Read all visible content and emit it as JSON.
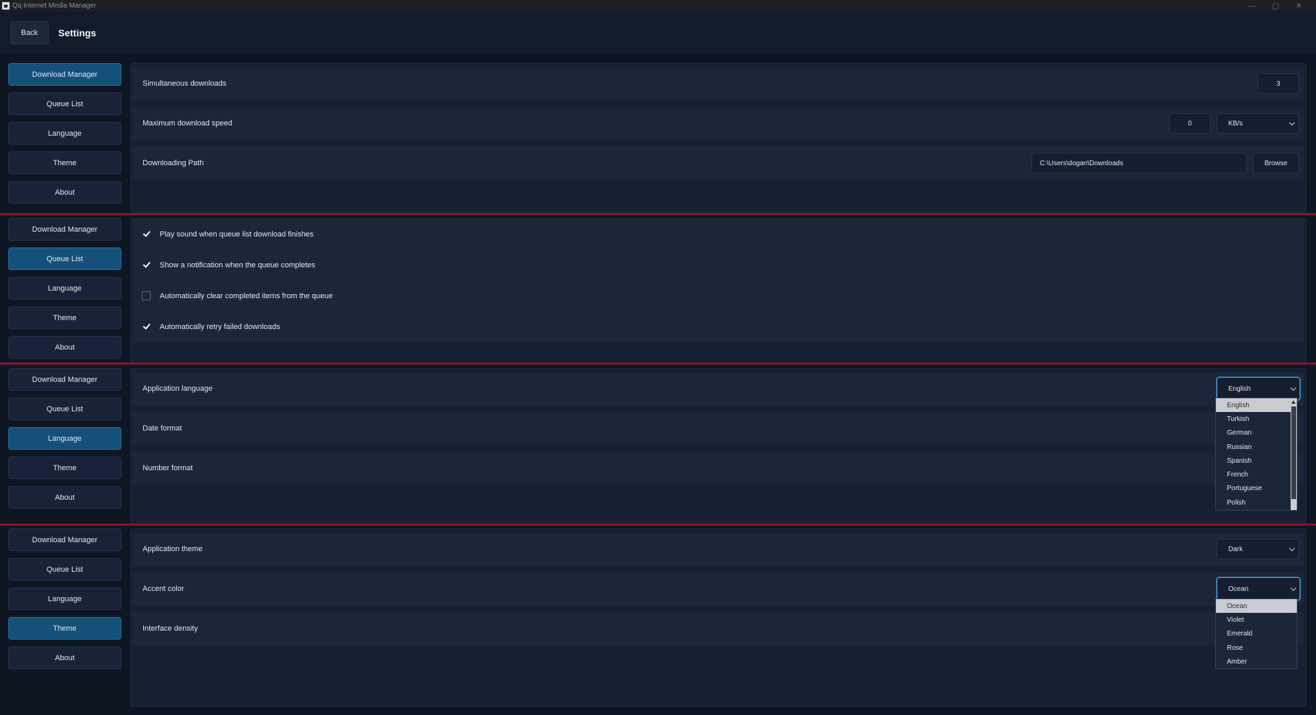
{
  "window": {
    "title": "Qq Internet Media Manager",
    "controls": [
      "—",
      "▢",
      "✕"
    ]
  },
  "header": {
    "back_label": "Back",
    "title": "Settings"
  },
  "nav": {
    "download_manager": "Download Manager",
    "queue_list": "Queue List",
    "language": "Language",
    "theme": "Theme",
    "about": "About"
  },
  "download_manager": {
    "simultaneous_label": "Simultaneous downloads",
    "simultaneous_value": "3",
    "max_speed_label": "Maximum download speed",
    "max_speed_value": "0",
    "max_speed_unit": "KB/s",
    "path_label": "Downloading Path",
    "path_value": "C:\\Users\\dogan\\Downloads",
    "browse_label": "Browse"
  },
  "queue_list": {
    "options": [
      {
        "label": "Play sound when queue list download finishes",
        "checked": true
      },
      {
        "label": "Show a notification when the queue completes",
        "checked": true
      },
      {
        "label": "Automatically clear completed items from the queue",
        "checked": false
      },
      {
        "label": "Automatically retry failed downloads",
        "checked": true
      }
    ]
  },
  "language": {
    "app_language_label": "Application language",
    "app_language_value": "English",
    "date_format_label": "Date format",
    "number_format_label": "Number format",
    "options": [
      "English",
      "Turkish",
      "German",
      "Russian",
      "Spanish",
      "French",
      "Portuguese",
      "Polish"
    ]
  },
  "theme": {
    "app_theme_label": "Application theme",
    "app_theme_value": "Dark",
    "accent_label": "Accent color",
    "accent_value": "Ocean",
    "density_label": "Interface density",
    "accent_options": [
      "Ocean",
      "Violet",
      "Emerald",
      "Rose",
      "Amber"
    ]
  },
  "colors": {
    "background": "#0e1623",
    "active_nav": "#14507a",
    "separator": "#7d1322",
    "focus_ring": "#5aa4e0"
  },
  "icons": [
    "app-icon",
    "chevron-down-icon",
    "checkmark-icon",
    "scroll-up-arrow-icon"
  ]
}
